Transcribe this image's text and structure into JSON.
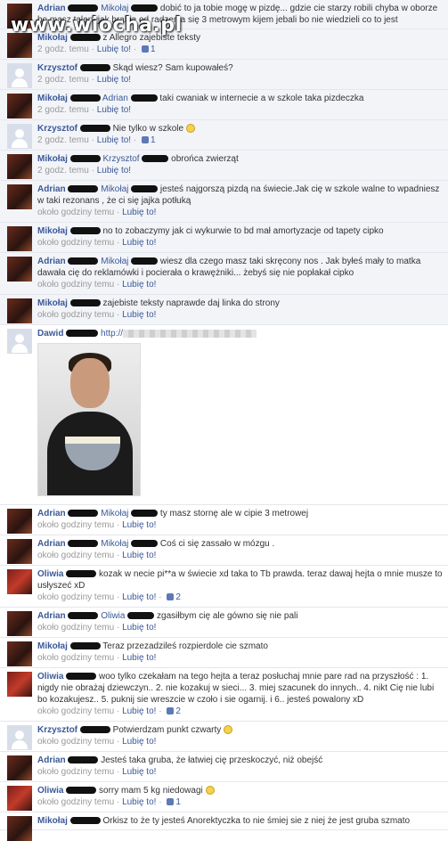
{
  "watermark": "www.wiocha.pl",
  "meta_sep": " · ",
  "like_label": "Lubię to!",
  "comments": [
    {
      "author": "Adrian",
      "mention": "Mikołaj",
      "text": "dobić to ja tobie mogę w pizdę... gdzie cie starzy robili chyba w oborze bo masz talent jak hrabia od radzenia się 3 metrowym kijem jebali bo nie wiedzieli co to jest",
      "time": "",
      "likes": "",
      "avatar": "av-dark",
      "white": false
    },
    {
      "author": "Mikołaj",
      "mention": "",
      "text": "z Allegro zajebiste teksty",
      "time": "2 godz. temu",
      "likes": "1",
      "avatar": "av-dark",
      "white": false
    },
    {
      "author": "Krzysztof",
      "mention": "",
      "text": "Skąd wiesz? Sam kupowałeś?",
      "time": "2 godz. temu",
      "likes": "",
      "avatar": "av-blank",
      "white": false
    },
    {
      "author": "Mikołaj",
      "mention": "Adrian",
      "text": "taki cwaniak w internecie a w szkole taka pizdeczka",
      "time": "2 godz. temu",
      "likes": "",
      "avatar": "av-dark",
      "white": false
    },
    {
      "author": "Krzysztof",
      "mention": "",
      "text": "Nie tylko w szkole",
      "time": "2 godz. temu",
      "likes": "1",
      "avatar": "av-blank",
      "white": false,
      "smiley": true
    },
    {
      "author": "Mikołaj",
      "mention": "Krzysztof",
      "text": "obrońca zwierząt",
      "time": "2 godz. temu",
      "likes": "",
      "avatar": "av-dark",
      "white": false
    },
    {
      "author": "Adrian",
      "mention": "Mikołaj",
      "text": "jesteś najgorszą pizdą na świecie.Jak cię w szkole walne to wpadniesz w taki rezonans , że ci się jajka potłuką",
      "time": "około godziny temu",
      "likes": "",
      "avatar": "av-dark",
      "white": false
    },
    {
      "author": "Mikołaj",
      "mention": "",
      "text": "no to zobaczymy jak ci wykurwie to bd mał amortyzacje od tapety cipko",
      "time": "około godziny temu",
      "likes": "",
      "avatar": "av-dark",
      "white": false
    },
    {
      "author": "Adrian",
      "mention": "Mikołaj",
      "text": "wiesz dla czego masz taki skręcony nos . Jak byłeś mały to matka dawała cię do reklamówki i pocierała o krawężniki... żebyś się nie popłakał cipko",
      "time": "około godziny temu",
      "likes": "",
      "avatar": "av-dark",
      "white": false
    },
    {
      "author": "Mikołaj",
      "mention": "",
      "text": "zajebiste teksty naprawde daj linka do strony",
      "time": "około godziny temu",
      "likes": "",
      "avatar": "av-dark",
      "white": false
    }
  ],
  "dawid": {
    "author": "Dawid",
    "text": "http://",
    "time": "około godziny temu"
  },
  "comments2": [
    {
      "author": "Adrian",
      "mention": "Mikołaj",
      "text": "ty masz stornę ale w cipie 3 metrowej",
      "time": "około godziny temu",
      "likes": "",
      "avatar": "av-dark",
      "white": true
    },
    {
      "author": "Adrian",
      "mention": "Mikołaj",
      "text": "Coś ci się zassało w mózgu .",
      "time": "około godziny temu",
      "likes": "",
      "avatar": "av-dark",
      "white": true
    },
    {
      "author": "Oliwia",
      "mention": "",
      "text": "kozak w necie pi**a w świecie xd taka to Tb prawda. teraz dawaj hejta o mnie musze to usłyszeć xD",
      "time": "około godziny temu",
      "likes": "2",
      "avatar": "av-red",
      "white": true
    },
    {
      "author": "Adrian",
      "mention": "Oliwia",
      "text": "zgasiłbym cię ale gówno się nie pali",
      "time": "około godziny temu",
      "likes": "",
      "avatar": "av-dark",
      "white": true
    },
    {
      "author": "Mikołaj",
      "mention": "",
      "text": "Teraz przezadzileś rozpierdole cie szmato",
      "time": "około godziny temu",
      "likes": "",
      "avatar": "av-dark",
      "white": true
    },
    {
      "author": "Oliwia",
      "mention": "",
      "text": "woo tylko czekałam na tego hejta a teraz posłuchaj mnie pare rad na przyszłość : 1. nigdy nie obrażaj dziewczyn.. 2. nie kozakuj w sieci... 3. miej szacunek do innych.. 4. nikt Cię nie lubi bo kozakujesz.. 5. puknij sie wreszcie w czoło i sie ogarnij. i 6.. jesteś powalony xD",
      "time": "około godziny temu",
      "likes": "2",
      "avatar": "av-red",
      "white": true
    },
    {
      "author": "Krzysztof",
      "mention": "",
      "text": "Potwierdzam punkt czwarty",
      "time": "około godziny temu",
      "likes": "",
      "avatar": "av-blank",
      "white": true,
      "smiley": true
    },
    {
      "author": "Adrian",
      "mention": "",
      "text": "Jesteś taka gruba, że łatwiej cię przeskoczyć, niż obejść",
      "time": "około godziny temu",
      "likes": "",
      "avatar": "av-dark",
      "white": true
    },
    {
      "author": "Oliwia",
      "mention": "",
      "text": "sorry mam 5 kg niedowagi",
      "time": "około godziny temu",
      "likes": "1",
      "avatar": "av-red",
      "white": true,
      "smiley": true
    },
    {
      "author": "Mikołaj",
      "mention": "",
      "text": "Orkisz to że ty jesteś Anorektyczka to nie śmiej sie z niej że jest gruba szmato",
      "time": "",
      "likes": "",
      "avatar": "av-dark",
      "white": true
    }
  ]
}
